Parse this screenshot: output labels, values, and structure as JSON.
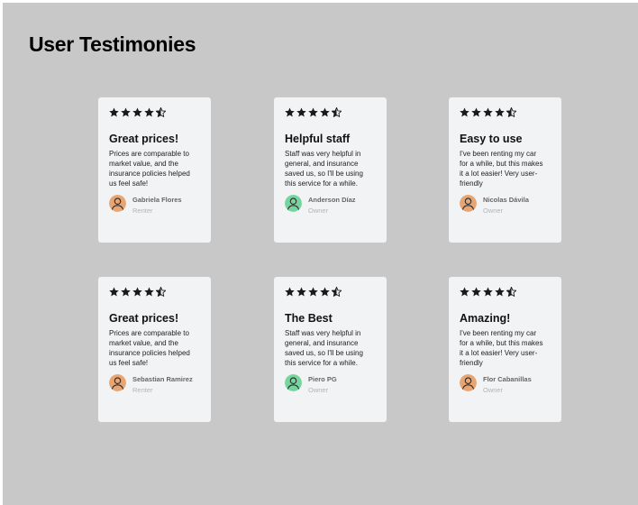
{
  "page": {
    "title": "User Testimonies"
  },
  "colors": {
    "background": "#c8c8c8",
    "card": "#f2f3f5",
    "avatar_orange": "#e8a574",
    "avatar_green": "#78d49e"
  },
  "testimonials": [
    {
      "rating": 4.5,
      "title": "Great prices!",
      "body": "Prices are comparable to\nmarket value, and the\ninsurance policies helped\nus feel safe!",
      "name": "Gabriela Flores",
      "role": "Renter",
      "avatar_color": "#e8a574"
    },
    {
      "rating": 4.5,
      "title": "Helpful staff",
      "body": "Staff was very helpful in\ngeneral, and insurance\nsaved us, so I'll be using\nthis service for a while.",
      "name": "Anderson Díaz",
      "role": "Owner",
      "avatar_color": "#78d49e"
    },
    {
      "rating": 4.5,
      "title": "Easy to use",
      "body": "I've been renting my car\nfor a while, but this  makes\nit a lot easier! Very user-\nfriendly",
      "name": "Nicolas Dávila",
      "role": "Owner",
      "avatar_color": "#e8a574"
    },
    {
      "rating": 4.5,
      "title": "Great prices!",
      "body": "Prices are comparable to\nmarket value, and the\ninsurance policies helped\nus feel safe!",
      "name": "Sebastian Ramirez",
      "role": "Renter",
      "avatar_color": "#e8a574"
    },
    {
      "rating": 4.5,
      "title": "The Best",
      "body": "Staff was very helpful in\ngeneral, and insurance\nsaved us, so I'll be using\nthis service for a while.",
      "name": "Piero PG",
      "role": "Owner",
      "avatar_color": "#78d49e"
    },
    {
      "rating": 4.5,
      "title": "Amazing!",
      "body": "I've been renting my car\nfor a while, but this  makes\nit a lot easier! Very user-\nfriendly",
      "name": "Flor Cabanillas",
      "role": "Owner",
      "avatar_color": "#e8a574"
    }
  ]
}
